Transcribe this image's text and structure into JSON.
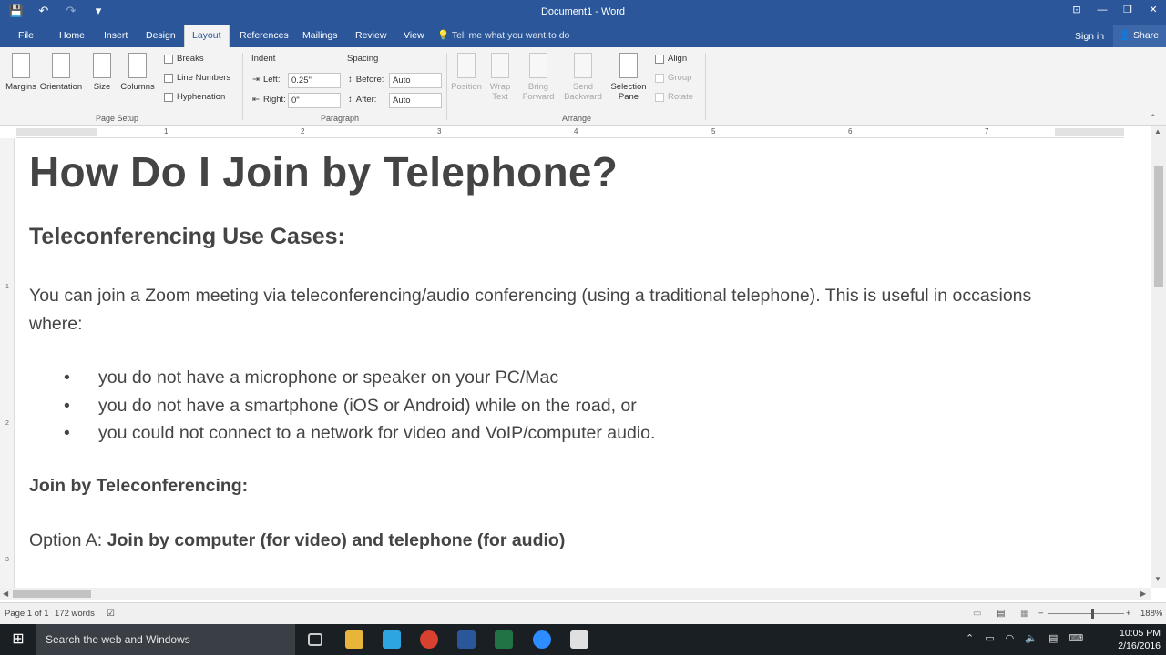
{
  "window": {
    "title": "Document1 - Word",
    "qat": {
      "save": "💾",
      "undo": "↶",
      "redo": "↷",
      "customize": "▾"
    },
    "controls": [
      "⊡",
      "—",
      "❐",
      "✕"
    ]
  },
  "tabs": [
    "File",
    "Home",
    "Insert",
    "Design",
    "Layout",
    "References",
    "Mailings",
    "Review",
    "View"
  ],
  "active_tab": "Layout",
  "tell_me": "Tell me what you want to do",
  "sign_in": "Sign in",
  "share": "Share",
  "ribbon": {
    "page_setup": {
      "label": "Page Setup",
      "margins": "Margins",
      "orientation": "Orientation",
      "size": "Size",
      "columns": "Columns",
      "breaks": "Breaks",
      "line_numbers": "Line Numbers",
      "hyphenation": "Hyphenation"
    },
    "paragraph": {
      "label": "Paragraph",
      "indent": "Indent",
      "left_label": "Left:",
      "left_value": "0.25\"",
      "right_label": "Right:",
      "right_value": "0\"",
      "spacing": "Spacing",
      "before_label": "Before:",
      "before_value": "Auto",
      "after_label": "After:",
      "after_value": "Auto"
    },
    "arrange": {
      "label": "Arrange",
      "position": "Position",
      "wrap_text": "Wrap Text",
      "bring_forward": "Bring Forward",
      "send_backward": "Send Backward",
      "selection_pane": "Selection Pane",
      "align": "Align",
      "group": "Group",
      "rotate": "Rotate"
    }
  },
  "ruler": {
    "numbers": [
      "1",
      "2",
      "3",
      "4",
      "5",
      "6",
      "7"
    ]
  },
  "vruler": {
    "numbers": [
      "1",
      "2",
      "3"
    ]
  },
  "document": {
    "heading1": "How Do I Join by Telephone?",
    "heading2": "Teleconferencing Use Cases:",
    "paragraph": "You can join a Zoom meeting via teleconferencing/audio conferencing (using a traditional telephone). This is useful in occasions where:",
    "bullet_glyph": "•",
    "bullets": [
      "you do not have a microphone or speaker on your PC/Mac",
      "you do not have a smartphone (iOS or Android) while on the road, or",
      "you could not connect to a network for video and VoIP/computer audio."
    ],
    "heading3": "Join by Teleconferencing:",
    "option_prefix": "Option A: ",
    "option_bold": "Join by computer (for video) and telephone (for audio)"
  },
  "status": {
    "page": "Page 1 of 1",
    "words": "172 words",
    "zoom": "188%"
  },
  "taskbar": {
    "search_placeholder": "Search the web and Windows",
    "time": "10:05 PM",
    "date": "2/16/2016"
  }
}
